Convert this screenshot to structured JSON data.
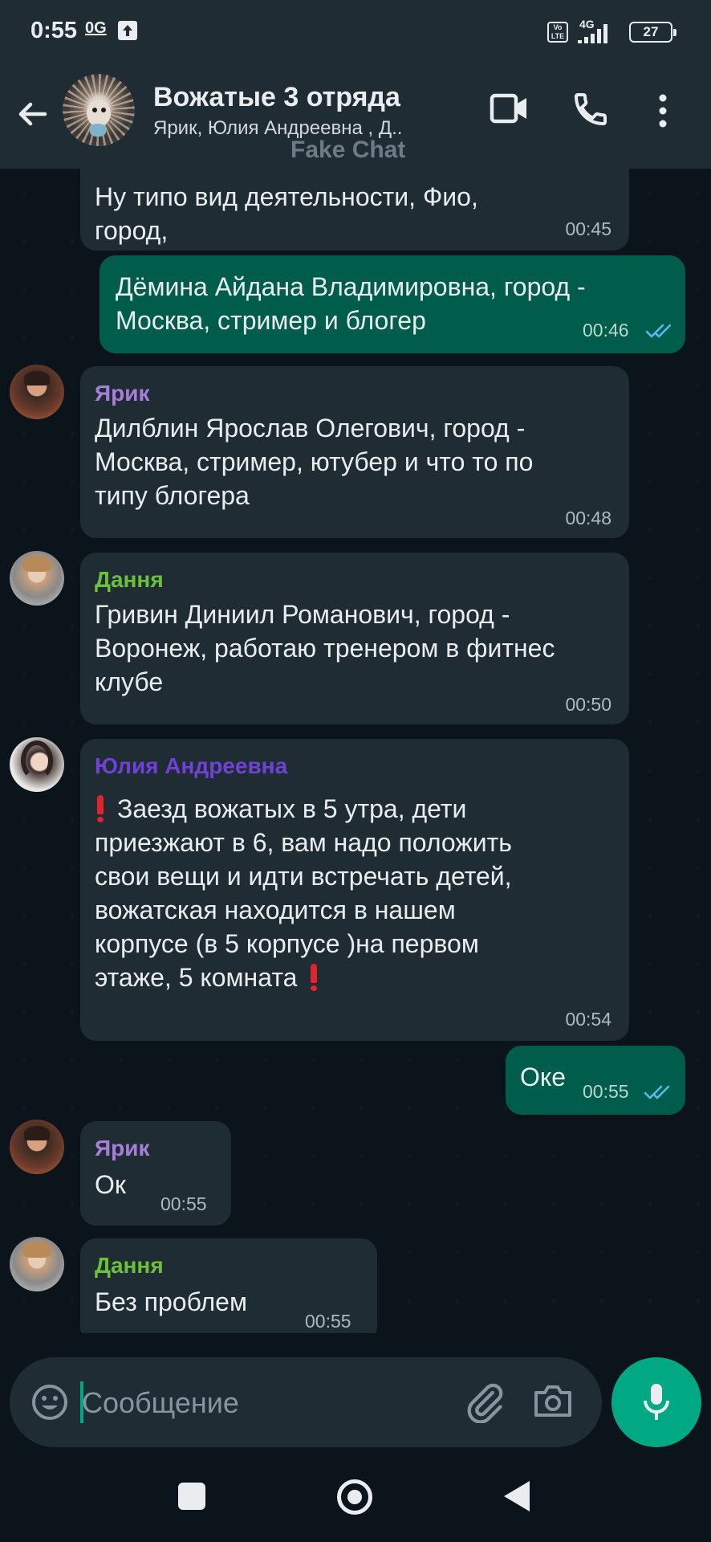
{
  "status": {
    "time": "0:55",
    "network_label": "0G",
    "volte_label": "Vo LTE",
    "network_type": "4G",
    "battery": "27"
  },
  "header": {
    "title": "Вожатые 3 отряда",
    "subtitle": "Ярик, Юлия Андреевна , Д..",
    "icons": [
      "back-arrow-icon",
      "group-avatar",
      "video-call-icon",
      "voice-call-icon",
      "more-menu-icon"
    ]
  },
  "watermark": "Fake Chat",
  "colors": {
    "incoming_bubble": "#1f2c34",
    "outgoing_bubble": "#005c4b",
    "accent": "#00a884",
    "read_ticks": "#53bdeb",
    "sender_yarik": "#a77fd9",
    "sender_dannya": "#6bc23a",
    "sender_yulia": "#6f42d6"
  },
  "messages": [
    {
      "direction": "in",
      "sender": "",
      "lines": [
        "Ну типо вид деятельности, Фио,",
        "город,"
      ],
      "time": "00:45"
    },
    {
      "direction": "out",
      "lines": [
        "Дёмина Айдана Владимировна, город -",
        "Москва, стример и блогер"
      ],
      "time": "00:46",
      "read": true
    },
    {
      "direction": "in",
      "sender": "Ярик",
      "lines": [
        "Дилблин Ярослав Олегович, город -",
        "Москва, стример, ютубер и что то по",
        "типу блогера"
      ],
      "time": "00:48"
    },
    {
      "direction": "in",
      "sender": "Дання",
      "lines": [
        "Гривин Диниил Романович, город -",
        "Воронеж, работаю тренером в фитнес",
        "клубе"
      ],
      "time": "00:50"
    },
    {
      "direction": "in",
      "sender": "Юлия Андреевна",
      "lines": [
        "Заезд вожатых в 5 утра, дети",
        "приезжают в 6, вам надо положить",
        "свои вещи и идти встречать детей,",
        "вожатская находится в нашем",
        "корпусе (в 5 корпусе )на первом",
        "этаже, 5 комната"
      ],
      "time": "00:54"
    },
    {
      "direction": "out",
      "lines": [
        "Оке"
      ],
      "time": "00:55",
      "read": true
    },
    {
      "direction": "in",
      "sender": "Ярик",
      "lines": [
        "Ок"
      ],
      "time": "00:55"
    },
    {
      "direction": "in",
      "sender": "Дання",
      "lines": [
        "Без проблем"
      ],
      "time": "00:55"
    }
  ],
  "input": {
    "placeholder": "Сообщение",
    "icons": [
      "emoji-icon",
      "attach-icon",
      "camera-icon",
      "mic-icon"
    ]
  },
  "navigation": [
    "recents-button",
    "home-button",
    "back-button"
  ]
}
